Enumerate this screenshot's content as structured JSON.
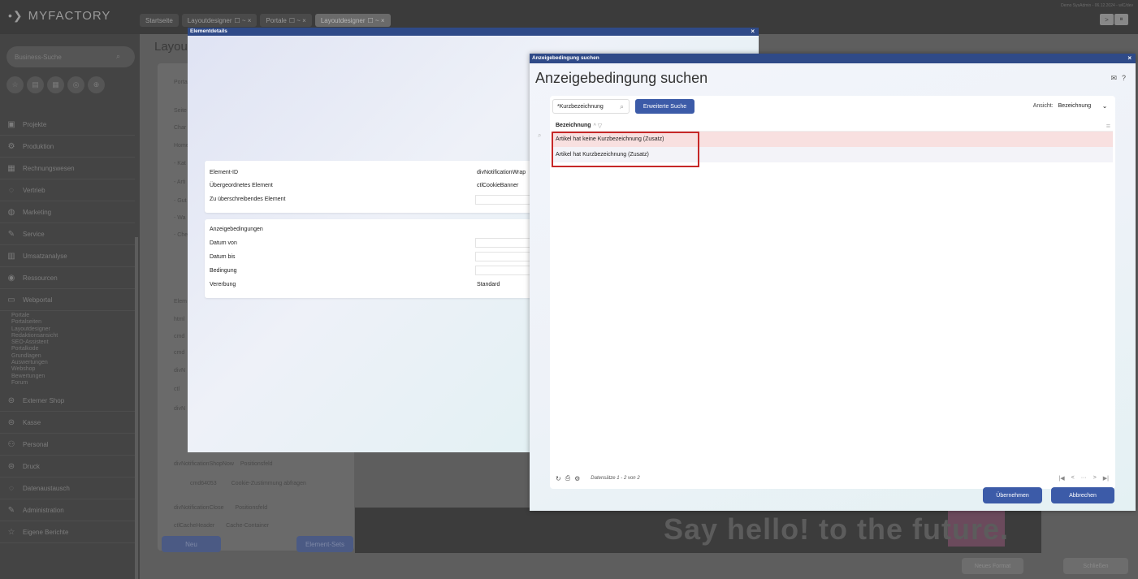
{
  "app": {
    "logo": "MYFACTORY",
    "user_info": "Demo SysAdmin - 06.12.2024 - wlC/dev"
  },
  "tabs": [
    {
      "label": "Startseite"
    },
    {
      "label": "Layoutdesigner",
      "suffix": "☐ ~ ×"
    },
    {
      "label": "Portale",
      "suffix": "☐ ~ ×"
    },
    {
      "label": "Layoutdesigner",
      "suffix": "☐ ~ ×"
    }
  ],
  "top_buttons": [
    ">",
    "⏸"
  ],
  "sidebar": {
    "search_placeholder": "Business-Suche",
    "items": [
      {
        "label": "Projekte",
        "icon": "folder-icon"
      },
      {
        "label": "Produktion",
        "icon": "gear-icon"
      },
      {
        "label": "Rechnungswesen",
        "icon": "calculator-icon"
      },
      {
        "label": "Vertrieb",
        "icon": "handshake-icon"
      },
      {
        "label": "Marketing",
        "icon": "globe-icon"
      },
      {
        "label": "Service",
        "icon": "wrench-icon"
      },
      {
        "label": "Umsatzanalyse",
        "icon": "chart-icon"
      },
      {
        "label": "Ressourcen",
        "icon": "check-circle-icon"
      },
      {
        "label": "Webportal",
        "icon": "window-icon"
      }
    ],
    "webportal_sub": [
      "Portale",
      "Portalseiten",
      "Layoutdesigner",
      "Redaktionsansicht",
      "SEO-Assistent",
      "Portalkode",
      "Grundlagen",
      "Auswertungen",
      "Webshop",
      "Bewertungen",
      "Forum"
    ],
    "items_after": [
      {
        "label": "Externer Shop",
        "icon": "shop-icon"
      },
      {
        "label": "Kasse",
        "icon": "register-icon"
      },
      {
        "label": "Personal",
        "icon": "people-icon"
      },
      {
        "label": "Druck",
        "icon": "printer-icon"
      },
      {
        "label": "Datenaustausch",
        "icon": "exchange-icon"
      },
      {
        "label": "Administration",
        "icon": "wrench-icon"
      },
      {
        "label": "Eigene Berichte",
        "icon": "star-icon"
      }
    ]
  },
  "background": {
    "title": "Layou",
    "panel_rows": [
      "Portal",
      "Seite",
      "Char",
      "Home",
      "- Kat",
      "- Arti",
      "- Gut",
      "- Wa",
      "- Che",
      "Elem",
      "html",
      "cmd",
      "cmd",
      "divN",
      "ctl",
      "divN"
    ],
    "rows": [
      {
        "name": "divNotificationShopNow",
        "type": "Positionsfeld"
      },
      {
        "name": "cmd64053",
        "type": "Cookie-Zustimmung abfragen"
      },
      {
        "name": "divNotificationClose",
        "type": "Positionsfeld"
      },
      {
        "name": "ctlCacheHeader",
        "type": "Cache-Container"
      }
    ],
    "new_button": "Neu",
    "element_sets_button": "Element-Sets",
    "banner_text": "Say hello! to the future.",
    "new_format_button": "Neues Format",
    "close_button": "Schließen"
  },
  "elementdetails": {
    "title": "Elementdetails",
    "close": "×",
    "fields": [
      {
        "label": "Element-ID",
        "value": "divNotificationWrap"
      },
      {
        "label": "Übergeordnetes Element",
        "value": "ctlCookieBanner"
      },
      {
        "label": "Zu überschreibendes Element",
        "value": ""
      }
    ],
    "section_title": "Anzeigebedingungen",
    "fields2": [
      {
        "label": "Datum von",
        "value": ""
      },
      {
        "label": "Datum bis",
        "value": ""
      },
      {
        "label": "Bedingung",
        "value": ""
      },
      {
        "label": "Vererbung",
        "value": "Standard"
      }
    ]
  },
  "search_dialog": {
    "header": "Anzeigebedingung suchen",
    "close": "×",
    "title": "Anzeigebedingung suchen",
    "search_field": "*Kurzbezeichnung",
    "advanced_button": "Erweiterte Suche",
    "view_label": "Ansicht:",
    "view_value": "Bezeichnung",
    "column_header": "Bezeichnung",
    "sort_marker": "^ ▽",
    "rows": [
      "Artikel hat keine Kurzbezeichnung (Zusatz)",
      "Artikel hat Kurzbezeichnung (Zusatz)"
    ],
    "record_count": "Datensätze 1 - 2 von 2",
    "pager": [
      "|◀",
      "<",
      "···",
      ">",
      "▶|"
    ],
    "apply_button": "Übernehmen",
    "cancel_button": "Abbrechen"
  }
}
